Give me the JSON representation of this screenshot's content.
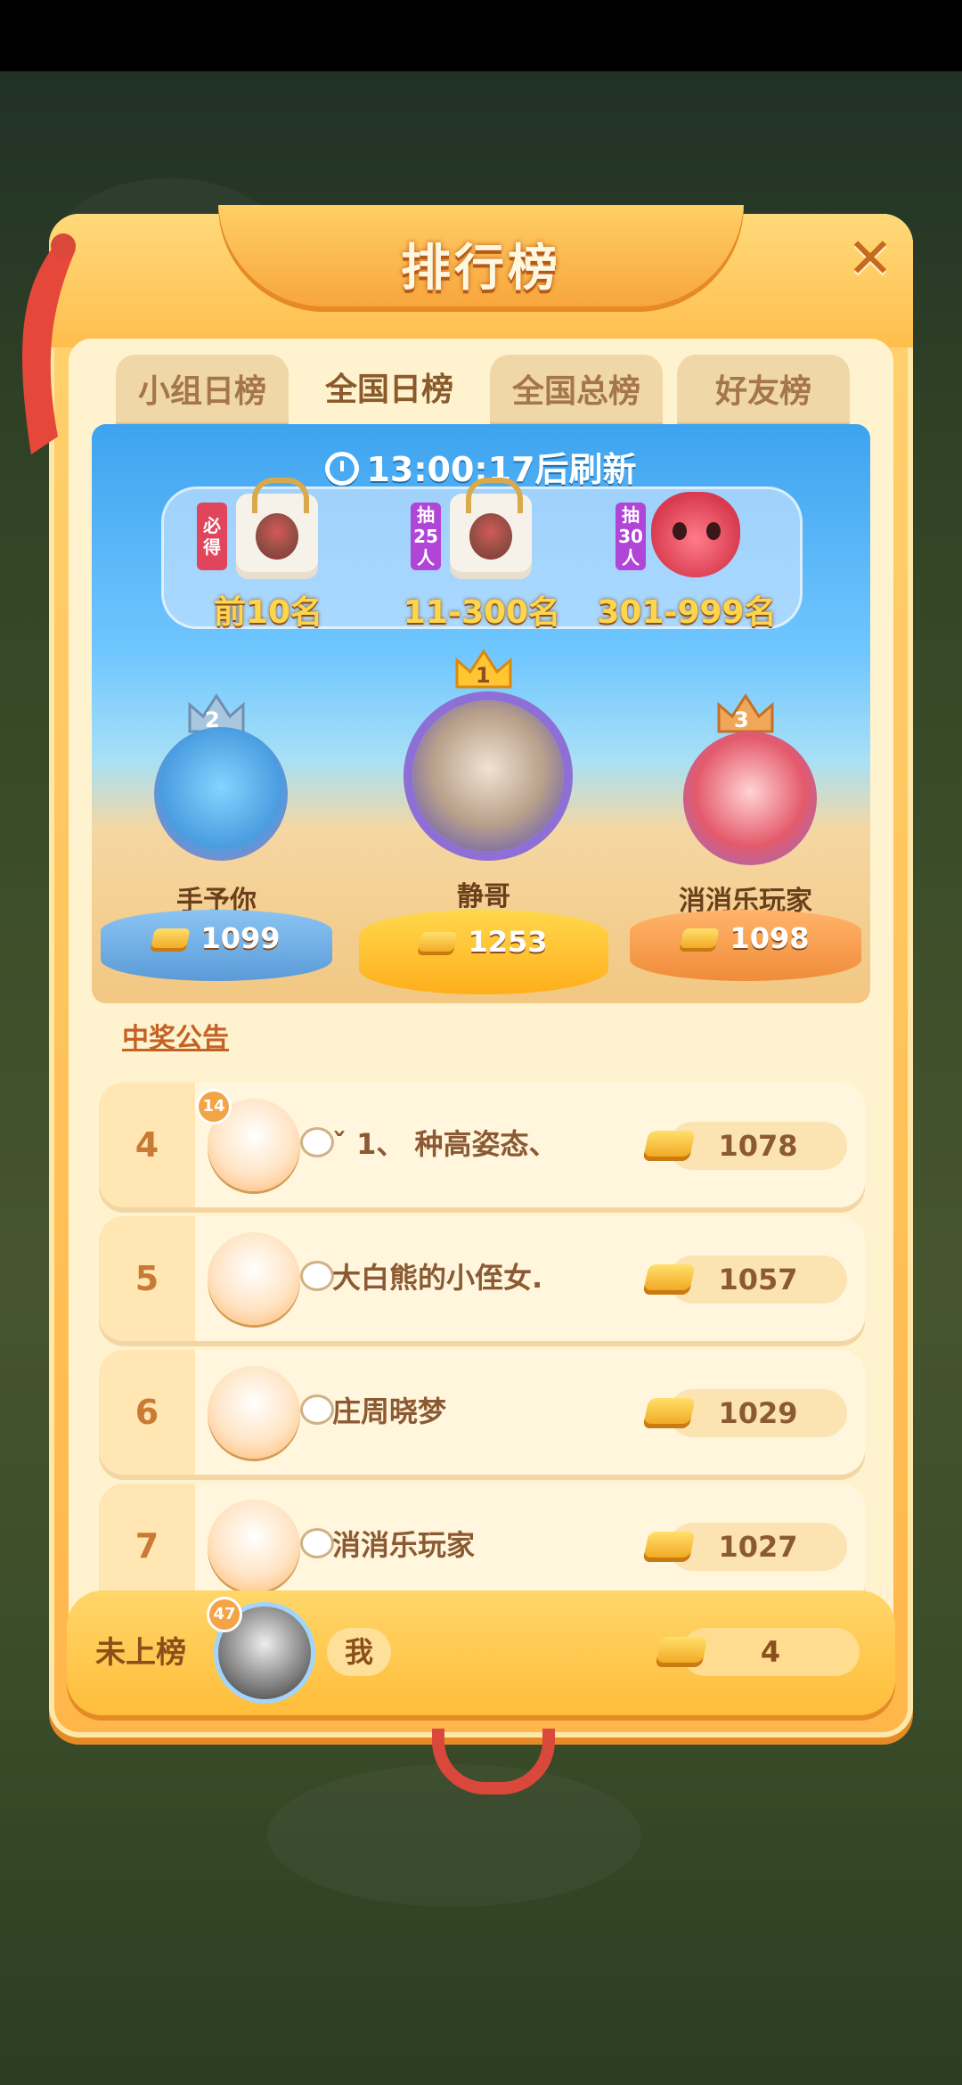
{
  "modal": {
    "title": "排行榜",
    "close_label": "✕"
  },
  "tabs": [
    {
      "label": "小组日榜",
      "active": false
    },
    {
      "label": "全国日榜",
      "active": true
    },
    {
      "label": "全国总榜",
      "active": false
    },
    {
      "label": "好友榜",
      "active": false
    }
  ],
  "arena": {
    "refresh_text": "13:00:17后刷新",
    "rewards": [
      {
        "tag": "必得",
        "label": "前10名",
        "icon": "bag-icon"
      },
      {
        "tag": "抽25人",
        "label": "11-300名",
        "icon": "bag-icon"
      },
      {
        "tag": "抽30人",
        "label": "301-999名",
        "icon": "fox-doll-icon"
      }
    ],
    "podium": [
      {
        "rank": "2",
        "name": "手予你",
        "score": "1099"
      },
      {
        "rank": "1",
        "name": "静哥",
        "score": "1253"
      },
      {
        "rank": "3",
        "name": "消消乐玩家",
        "score": "1098"
      }
    ]
  },
  "notice_link": "中奖公告",
  "rows": [
    {
      "rank": "4",
      "level": "14",
      "name": "ˇ 1、 种高姿态、",
      "score": "1078"
    },
    {
      "rank": "5",
      "name": "大白熊的小侄女.",
      "score": "1057"
    },
    {
      "rank": "6",
      "name": "庄周晓梦",
      "score": "1029"
    },
    {
      "rank": "7",
      "name": "消消乐玩家",
      "score": "1027"
    }
  ],
  "me": {
    "rank": "未上榜",
    "level": "47",
    "name": "我",
    "score": "4"
  },
  "colors": {
    "accent": "#ffbd3a",
    "frame": "#ffd26f",
    "tab_active": "#fff3cf"
  }
}
